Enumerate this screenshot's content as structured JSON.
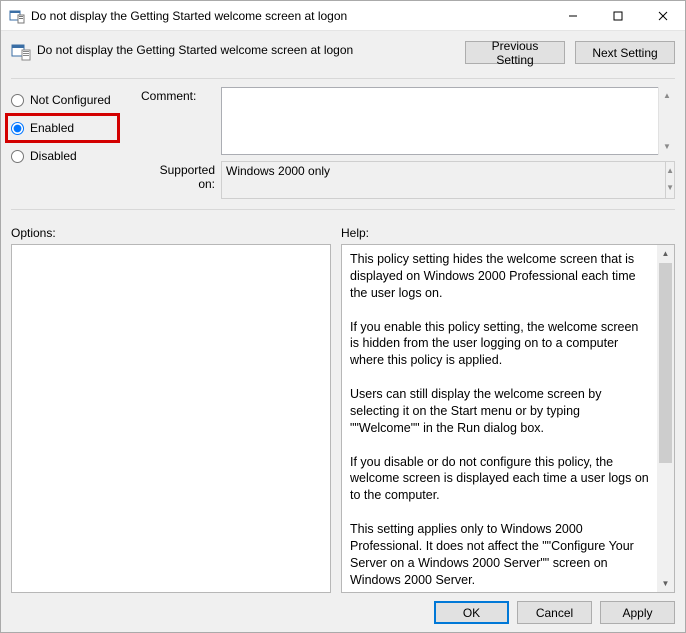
{
  "window": {
    "title": "Do not display the Getting Started welcome screen at logon"
  },
  "header": {
    "policy_name": "Do not display the Getting Started welcome screen at logon",
    "prev_label": "Previous Setting",
    "next_label": "Next Setting"
  },
  "state": {
    "options": [
      {
        "value": "not_configured",
        "label": "Not Configured"
      },
      {
        "value": "enabled",
        "label": "Enabled"
      },
      {
        "value": "disabled",
        "label": "Disabled"
      }
    ],
    "selected": "enabled"
  },
  "fields": {
    "comment_label": "Comment:",
    "comment_value": "",
    "supported_label": "Supported on:",
    "supported_value": "Windows 2000 only"
  },
  "sections": {
    "options_label": "Options:",
    "help_label": "Help:"
  },
  "help_text": "This policy setting hides the welcome screen that is displayed on Windows 2000 Professional each time the user logs on.\n\nIf you enable this policy setting, the welcome screen is hidden from the user logging on to a computer where this policy is applied.\n\nUsers can still display the welcome screen by selecting it on the Start menu or by typing \"\"Welcome\"\" in the Run dialog box.\n\nIf you disable or do not configure this policy, the welcome screen is displayed each time a user logs on to the computer.\n\nThis setting applies only to Windows 2000 Professional. It does not affect the \"\"Configure Your Server on a Windows 2000 Server\"\" screen on Windows 2000 Server.\n\nNote: This setting appears in the Computer Configuration and User Configuration folders. If both settings are configured, the setting in Computer Configuration takes precedence over the setting in User Configuration.",
  "buttons": {
    "ok": "OK",
    "cancel": "Cancel",
    "apply": "Apply"
  }
}
